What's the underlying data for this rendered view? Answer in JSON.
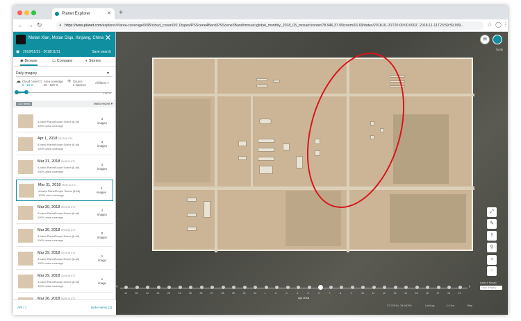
{
  "browser": {
    "tab_title": "Planet Explorer",
    "new_tab": "+",
    "url_host": "https://www.planet.com",
    "url_path": "/explorer/#/area-coverage/0/95/cloud_cover/0/0.1/types/PSScene4Band,PSScene3Band/mosaic/global_monthly_2018_03_mosaic/center/78.946,37.09/zoom/16.69/dates/2018-01-31T20:00:00.000Z..2018-11-11T23:59:59.999..."
  },
  "sidebar": {
    "location": "Motan Xian, Motan Diqu, Xinjiang, China",
    "close": "✕",
    "dates": "2018/01/31 - 2018/11/11",
    "save_label": "Save search",
    "tabs": [
      "Browse",
      "Compare",
      "Stories"
    ],
    "imagery_select": "Daily imagery",
    "filters": [
      {
        "label": "Cloud cover",
        "value": "0 - 10 %"
      },
      {
        "label": "Area coverage",
        "value": "20 - 100 %"
      },
      {
        "label": "Source",
        "value": "2 sources"
      },
      {
        "label": "All filters",
        "value": ">"
      }
    ],
    "slider_min": "0 %",
    "slider_max": "100 %",
    "slider_range": [
      0,
      0.1
    ],
    "list_badge": "122 items",
    "sort": "Most recent",
    "items": [
      {
        "date": "",
        "time": "",
        "meta1": "4-band PlanetScope Scene (8-bit)",
        "meta2": "100% area coverage",
        "count": "3",
        "unit": "images",
        "selected": false
      },
      {
        "date": "Apr 1, 2018",
        "time": "05:37:56 UTC",
        "meta1": "4-band PlanetScope Scene (8-bit)",
        "meta2": "100% area coverage",
        "count": "3",
        "unit": "images",
        "selected": false
      },
      {
        "date": "Mar 31, 2018",
        "time": "05:08:29 UTC",
        "meta1": "4-band PlanetScope Scene (8-bit)",
        "meta2": "100% area coverage",
        "count": "3",
        "unit": "images",
        "selected": false
      },
      {
        "date": "Mar 31, 2018",
        "time": "05:08:13 UTC",
        "meta1": "4-band PlanetScope Scene (8-bit)",
        "meta2": "100% area coverage",
        "count": "3",
        "unit": "images",
        "selected": true
      },
      {
        "date": "Mar 30, 2018",
        "time": "05:03:48 UTC",
        "meta1": "4-band PlanetScope Scene (8-bit)",
        "meta2": "100% area coverage",
        "count": "4",
        "unit": "images",
        "selected": false
      },
      {
        "date": "Mar 30, 2018",
        "time": "05:06:58 UTC",
        "meta1": "4-band PlanetScope Scene (8-bit)",
        "meta2": "100% area coverage",
        "count": "8",
        "unit": "images",
        "selected": false
      },
      {
        "date": "Mar 29, 2018",
        "time": "04:19:48 UTC",
        "meta1": "3-band PlanetScope Scene (8-bit)",
        "meta2": "100% area coverage",
        "count": "1",
        "unit": "image",
        "selected": false
      },
      {
        "date": "Mar 29, 2018",
        "time": "04:49:45 UTC",
        "meta1": "3-band PlanetScope Scene (8-bit)",
        "meta2": "100% area coverage",
        "count": "1",
        "unit": "image",
        "selected": false
      },
      {
        "date": "Mar 26, 2018",
        "time": "05:09:15 UTC",
        "meta1": "4-band PlanetScope Scene (8-bit)",
        "meta2": "100% area coverage",
        "count": "1",
        "unit": "image",
        "selected": false
      }
    ],
    "footer_left": "API ( )",
    "footer_right": "Order items (3)"
  },
  "map": {
    "user_label": "Tools",
    "timeline_month": "Apr 2018",
    "timeline_ticks": [
      "19",
      "20",
      "21",
      "22",
      "23",
      "24",
      "25",
      "26",
      "27",
      "28",
      "29",
      "30",
      "31",
      "1",
      "2",
      "3",
      "4",
      "5",
      "6",
      "7",
      "8",
      "9",
      "10",
      "11",
      "12",
      "13",
      "14",
      "15",
      "16",
      "17",
      "18",
      "19"
    ],
    "selected_tick_index": 18,
    "layers_label": "Label & Mosaic",
    "layers_value": "Daily Imagery",
    "status": [
      "37.07914, 78.94799",
      "Lat/Lng",
      "1:4 km",
      "Help"
    ],
    "colors": {
      "annotation": "#d9141b",
      "accent": "#0f8f9f"
    }
  }
}
